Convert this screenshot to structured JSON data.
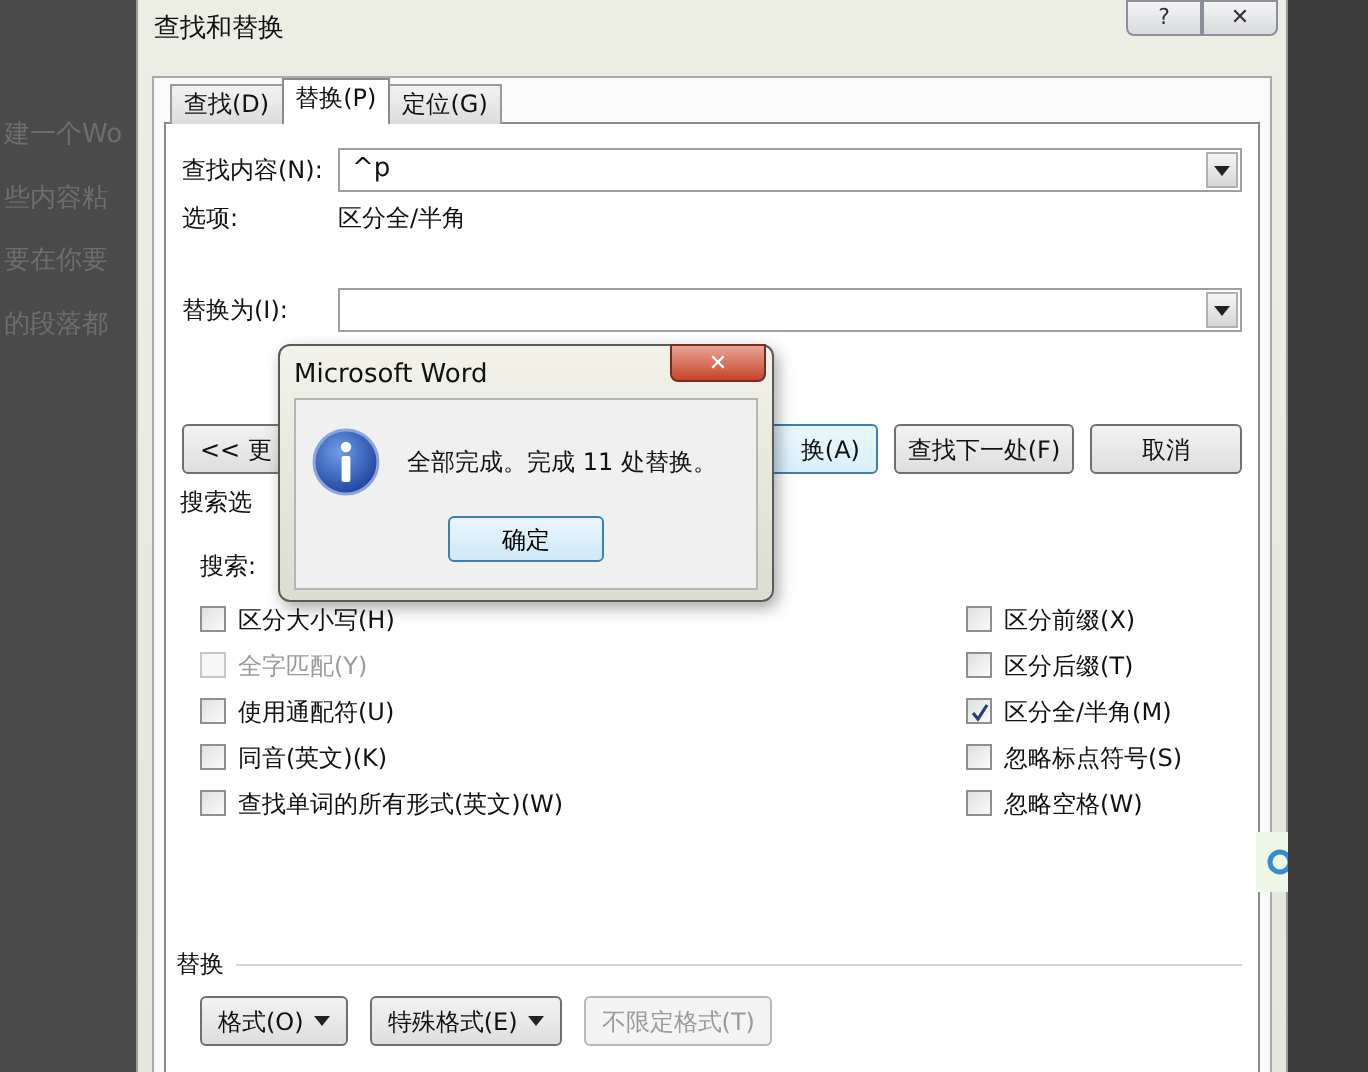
{
  "background_text": [
    "建一个Wo",
    "些内容粘",
    "要在你要",
    "的段落都"
  ],
  "dialog": {
    "title": "查找和替换",
    "help": "?",
    "close": "✕"
  },
  "tabs": [
    {
      "label": "查找(D)",
      "selected": false
    },
    {
      "label": "替换(P)",
      "selected": true
    },
    {
      "label": "定位(G)",
      "selected": false
    }
  ],
  "find": {
    "label": "查找内容(N):",
    "value": "^p"
  },
  "options": {
    "label": "选项:",
    "value": "区分全/半角"
  },
  "replace": {
    "label": "替换为(I):"
  },
  "action_buttons": [
    {
      "label": "<< 更",
      "kind": "cut-right"
    },
    {
      "label": "换(A)",
      "kind": "cut-left"
    },
    {
      "label": "查找下一处(F)",
      "kind": "full"
    },
    {
      "label": "取消",
      "kind": "full"
    }
  ],
  "search_options_label": "搜索选",
  "search_label": "搜索:",
  "left_options": [
    {
      "label": "区分大小写(H)",
      "checked": false,
      "disabled": false
    },
    {
      "label": "全字匹配(Y)",
      "checked": false,
      "disabled": true
    },
    {
      "label": "使用通配符(U)",
      "checked": false,
      "disabled": false
    },
    {
      "label": "同音(英文)(K)",
      "checked": false,
      "disabled": false
    },
    {
      "label": "查找单词的所有形式(英文)(W)",
      "checked": false,
      "disabled": false
    }
  ],
  "right_options": [
    {
      "label": "区分前缀(X)",
      "checked": false,
      "disabled": false
    },
    {
      "label": "区分后缀(T)",
      "checked": false,
      "disabled": false
    },
    {
      "label": "区分全/半角(M)",
      "checked": true,
      "disabled": false
    },
    {
      "label": "忽略标点符号(S)",
      "checked": false,
      "disabled": false
    },
    {
      "label": "忽略空格(W)",
      "checked": false,
      "disabled": false
    }
  ],
  "replace_group": {
    "label": "替换",
    "buttons": [
      {
        "label": "格式(O)",
        "dropdown": true,
        "disabled": false
      },
      {
        "label": "特殊格式(E)",
        "dropdown": true,
        "disabled": false
      },
      {
        "label": "不限定格式(T)",
        "dropdown": false,
        "disabled": true
      }
    ]
  },
  "message_box": {
    "title": "Microsoft Word",
    "close": "✕",
    "message": "全部完成。完成 11 处替换。",
    "ok": "确定"
  }
}
